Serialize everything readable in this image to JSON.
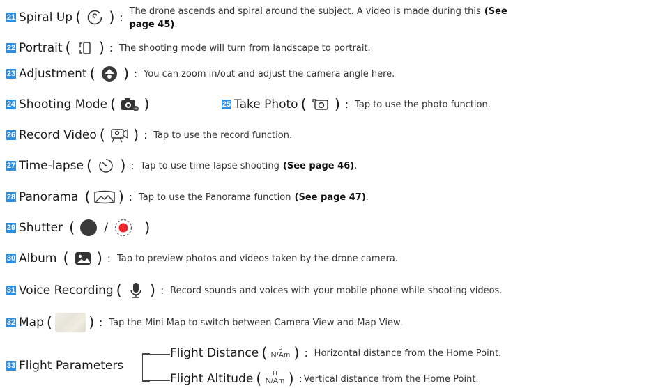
{
  "items": [
    {
      "num": "21",
      "term": "Spiral Up",
      "desc_line1": "The drone ascends and spiral around the subject. A video is made during this",
      "bold1": "(See",
      "desc_line2": "",
      "bold2": "page 45)",
      "tail": "."
    },
    {
      "num": "22",
      "term": "Portrait",
      "desc": "The shooting mode will turn from landscape to portrait."
    },
    {
      "num": "23",
      "term": "Adjustment",
      "desc": "You can zoom in/out and adjust the camera angle here."
    },
    {
      "num": "24",
      "term": "Shooting Mode"
    },
    {
      "num": "25",
      "term": "Take Photo",
      "desc": "Tap to use the photo function."
    },
    {
      "num": "26",
      "term": "Record Video",
      "desc": "Tap to use the record function."
    },
    {
      "num": "27",
      "term": "Time-lapse",
      "desc": "Tap to use time-lapse shooting",
      "bold": "(See page 46)",
      "tail": "."
    },
    {
      "num": "28",
      "term": "Panorama",
      "desc": "Tap to use the Panorama function",
      "bold": "(See page 47)",
      "tail": "."
    },
    {
      "num": "29",
      "term": "Shutter",
      "sep": "/"
    },
    {
      "num": "30",
      "term": "Album",
      "desc": "Tap to preview photos and videos taken by the drone camera."
    },
    {
      "num": "31",
      "term": "Voice Recording",
      "desc": "Record sounds and voices with your mobile phone while shooting videos."
    },
    {
      "num": "32",
      "term": "Map",
      "desc": "Tap the Mini Map to switch between Camera View and Map View."
    },
    {
      "num": "33",
      "term": "Flight Parameters"
    }
  ],
  "flight": {
    "distance": {
      "term": "Flight Distance",
      "top": "D",
      "bot": "N/Am",
      "desc": "Horizontal distance from the Home Point."
    },
    "altitude": {
      "term": "Flight Altitude",
      "top": "H",
      "bot": "N/Am",
      "desc": "Vertical distance from the Home Point."
    }
  },
  "punct": {
    "open": "(",
    "close": ")",
    "colon": ":"
  },
  "colors": {
    "badge": "#2d8fe0",
    "record": "#e8232a",
    "text": "#222222"
  },
  "icons": [
    "spiral-icon",
    "portrait-icon",
    "adjustment-icon",
    "shooting-mode-icon",
    "take-photo-icon",
    "record-video-icon",
    "timer-icon",
    "panorama-icon",
    "shutter-icon",
    "record-shutter-icon",
    "album-icon",
    "microphone-icon",
    "map-thumbnail"
  ]
}
